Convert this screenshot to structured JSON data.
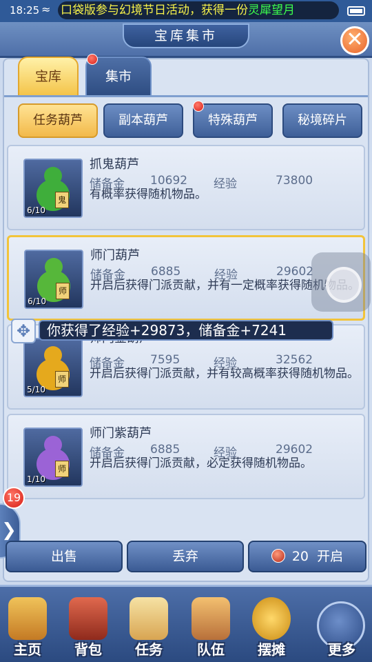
{
  "status_bar": {
    "time": "18:25",
    "marquee_text": "口袋版参与幻境节日活动，获得一份",
    "marquee_highlight": "灵犀望月"
  },
  "header": {
    "title": "宝库集市",
    "close_icon": "close-icon"
  },
  "tabs": [
    {
      "label": "宝库",
      "active": true
    },
    {
      "label": "集市",
      "active": false,
      "has_dot": true
    }
  ],
  "subtabs": [
    {
      "label": "任务葫芦",
      "active": true
    },
    {
      "label": "副本葫芦",
      "active": false
    },
    {
      "label": "特殊葫芦",
      "active": false,
      "has_dot": true
    },
    {
      "label": "秘境碎片",
      "active": false
    }
  ],
  "items": [
    {
      "name": "抓鬼葫芦",
      "count": "6/10",
      "reserve_label": "储备金",
      "reserve": "10692",
      "exp_label": "经验",
      "exp": "73800",
      "desc": "有概率获得随机物品。",
      "tag": "鬼",
      "color": "#3fae3b"
    },
    {
      "name": "师门葫芦",
      "count": "6/10",
      "reserve_label": "储备金",
      "reserve": "6885",
      "exp_label": "经验",
      "exp": "29602",
      "desc": "开启后获得门派贡献，并有一定概率获得随机物品。",
      "tag": "师",
      "color": "#56b73a"
    },
    {
      "name": "师门金葫芦",
      "count": "5/10",
      "reserve_label": "储备金",
      "reserve": "7595",
      "exp_label": "经验",
      "exp": "32562",
      "desc": "开启后获得门派贡献，并有较高概率获得随机物品。",
      "tag": "师",
      "color": "#e5a91d"
    },
    {
      "name": "师门紫葫芦",
      "count": "1/10",
      "reserve_label": "储备金",
      "reserve": "6885",
      "exp_label": "经验",
      "exp": "29602",
      "desc": "开启后获得门派贡献，必定获得随机物品。",
      "tag": "师",
      "color": "#9b63d6"
    }
  ],
  "toast": {
    "text": "你获得了经验+29873，储备金+7241"
  },
  "side": {
    "badge": "19"
  },
  "actions": {
    "sell": "出售",
    "discard": "丢弃",
    "open_count": "20",
    "open": "开启"
  },
  "nav": [
    {
      "label": "主页",
      "icon": "home-icon",
      "color": "#e0a53b"
    },
    {
      "label": "背包",
      "icon": "bag-chest-icon",
      "color": "#c7432e"
    },
    {
      "label": "任务",
      "icon": "scroll-icon",
      "color": "#e8c87a"
    },
    {
      "label": "队伍",
      "icon": "team-icon",
      "color": "#e2a24e"
    },
    {
      "label": "摆摊",
      "icon": "coin-icon",
      "color": "#f0b72b"
    },
    {
      "label": "更多",
      "icon": "more-icon",
      "color": "#5d82c4"
    }
  ]
}
